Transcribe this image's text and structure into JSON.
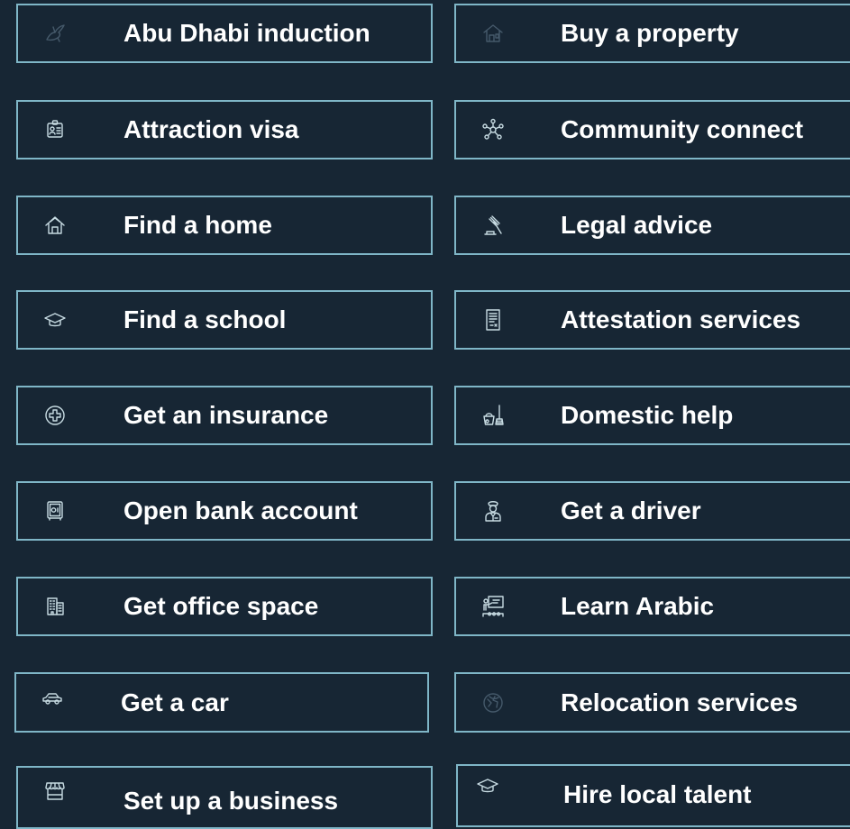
{
  "services": {
    "left": [
      {
        "label": "Abu Dhabi induction",
        "icon": "falcon-icon"
      },
      {
        "label": "Attraction visa",
        "icon": "id-badge-icon"
      },
      {
        "label": "Find a home",
        "icon": "house-icon"
      },
      {
        "label": "Find a school",
        "icon": "graduation-cap-icon"
      },
      {
        "label": "Get an insurance",
        "icon": "medical-cross-icon"
      },
      {
        "label": "Open bank account",
        "icon": "safe-icon"
      },
      {
        "label": "Get office space",
        "icon": "office-building-icon"
      },
      {
        "label": "Get a car",
        "icon": "car-icon"
      },
      {
        "label": "Set up a business",
        "icon": "storefront-icon"
      }
    ],
    "right": [
      {
        "label": "Buy a property",
        "icon": "property-icon"
      },
      {
        "label": "Community connect",
        "icon": "network-icon"
      },
      {
        "label": "Legal advice",
        "icon": "gavel-icon"
      },
      {
        "label": "Attestation services",
        "icon": "document-icon"
      },
      {
        "label": "Domestic help",
        "icon": "cleaning-bucket-icon"
      },
      {
        "label": "Get a driver",
        "icon": "chauffeur-icon"
      },
      {
        "label": "Learn Arabic",
        "icon": "teacher-board-icon"
      },
      {
        "label": "Relocation services",
        "icon": "relocation-globe-icon"
      },
      {
        "label": "Hire local talent",
        "icon": "graduation-cap-icon"
      }
    ]
  },
  "colors": {
    "background": "#172634",
    "tile_border": "#7fb6c7",
    "label_text": "#ffffff",
    "icon": "#c7dbe2",
    "icon_dim": "#45596a"
  }
}
